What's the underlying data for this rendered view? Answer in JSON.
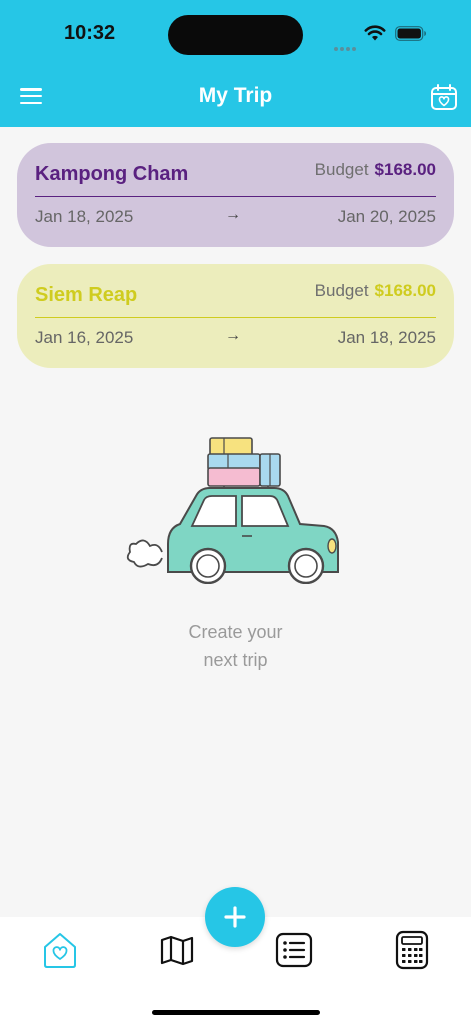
{
  "status_bar": {
    "time": "10:32"
  },
  "header": {
    "title": "My Trip"
  },
  "trips": [
    {
      "name": "Kampong Cham",
      "budget_label": "Budget",
      "budget_value": "$168.00",
      "start_date": "Jan 18, 2025",
      "end_date": "Jan 20, 2025",
      "arrow": "→",
      "card_color": "#d1c5dc",
      "accent_color": "#5a2180"
    },
    {
      "name": "Siem Reap",
      "budget_label": "Budget",
      "budget_value": "$168.00",
      "start_date": "Jan 16, 2025",
      "end_date": "Jan 18, 2025",
      "arrow": "→",
      "card_color": "#ecedbc",
      "accent_color": "#cfcc1f"
    }
  ],
  "empty_state": {
    "line1": "Create your",
    "line2": "next trip"
  },
  "bottom_nav": {
    "items": [
      {
        "icon": "home-heart-icon"
      },
      {
        "icon": "map-icon"
      },
      {
        "icon": "list-icon"
      },
      {
        "icon": "calculator-icon"
      }
    ],
    "fab_icon": "plus-icon"
  },
  "colors": {
    "primary": "#26c6e6",
    "background": "#f6f6f6"
  }
}
